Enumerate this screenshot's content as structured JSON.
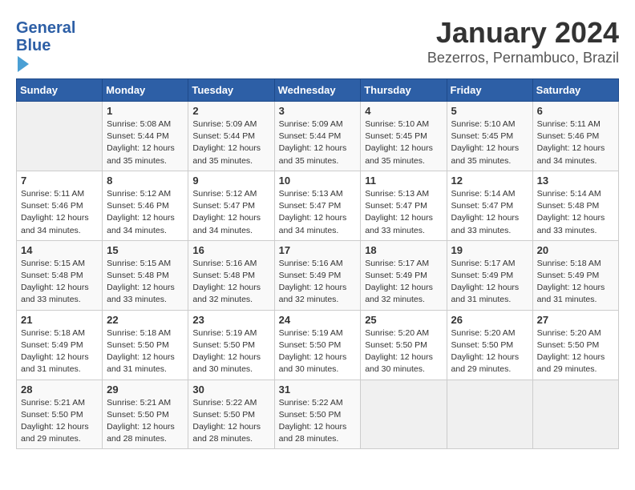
{
  "logo": {
    "line1": "General",
    "line2": "Blue"
  },
  "title": "January 2024",
  "subtitle": "Bezerros, Pernambuco, Brazil",
  "days_header": [
    "Sunday",
    "Monday",
    "Tuesday",
    "Wednesday",
    "Thursday",
    "Friday",
    "Saturday"
  ],
  "weeks": [
    [
      {
        "day": "",
        "info": ""
      },
      {
        "day": "1",
        "info": "Sunrise: 5:08 AM\nSunset: 5:44 PM\nDaylight: 12 hours\nand 35 minutes."
      },
      {
        "day": "2",
        "info": "Sunrise: 5:09 AM\nSunset: 5:44 PM\nDaylight: 12 hours\nand 35 minutes."
      },
      {
        "day": "3",
        "info": "Sunrise: 5:09 AM\nSunset: 5:44 PM\nDaylight: 12 hours\nand 35 minutes."
      },
      {
        "day": "4",
        "info": "Sunrise: 5:10 AM\nSunset: 5:45 PM\nDaylight: 12 hours\nand 35 minutes."
      },
      {
        "day": "5",
        "info": "Sunrise: 5:10 AM\nSunset: 5:45 PM\nDaylight: 12 hours\nand 35 minutes."
      },
      {
        "day": "6",
        "info": "Sunrise: 5:11 AM\nSunset: 5:46 PM\nDaylight: 12 hours\nand 34 minutes."
      }
    ],
    [
      {
        "day": "7",
        "info": "Sunrise: 5:11 AM\nSunset: 5:46 PM\nDaylight: 12 hours\nand 34 minutes."
      },
      {
        "day": "8",
        "info": "Sunrise: 5:12 AM\nSunset: 5:46 PM\nDaylight: 12 hours\nand 34 minutes."
      },
      {
        "day": "9",
        "info": "Sunrise: 5:12 AM\nSunset: 5:47 PM\nDaylight: 12 hours\nand 34 minutes."
      },
      {
        "day": "10",
        "info": "Sunrise: 5:13 AM\nSunset: 5:47 PM\nDaylight: 12 hours\nand 34 minutes."
      },
      {
        "day": "11",
        "info": "Sunrise: 5:13 AM\nSunset: 5:47 PM\nDaylight: 12 hours\nand 33 minutes."
      },
      {
        "day": "12",
        "info": "Sunrise: 5:14 AM\nSunset: 5:47 PM\nDaylight: 12 hours\nand 33 minutes."
      },
      {
        "day": "13",
        "info": "Sunrise: 5:14 AM\nSunset: 5:48 PM\nDaylight: 12 hours\nand 33 minutes."
      }
    ],
    [
      {
        "day": "14",
        "info": "Sunrise: 5:15 AM\nSunset: 5:48 PM\nDaylight: 12 hours\nand 33 minutes."
      },
      {
        "day": "15",
        "info": "Sunrise: 5:15 AM\nSunset: 5:48 PM\nDaylight: 12 hours\nand 33 minutes."
      },
      {
        "day": "16",
        "info": "Sunrise: 5:16 AM\nSunset: 5:48 PM\nDaylight: 12 hours\nand 32 minutes."
      },
      {
        "day": "17",
        "info": "Sunrise: 5:16 AM\nSunset: 5:49 PM\nDaylight: 12 hours\nand 32 minutes."
      },
      {
        "day": "18",
        "info": "Sunrise: 5:17 AM\nSunset: 5:49 PM\nDaylight: 12 hours\nand 32 minutes."
      },
      {
        "day": "19",
        "info": "Sunrise: 5:17 AM\nSunset: 5:49 PM\nDaylight: 12 hours\nand 31 minutes."
      },
      {
        "day": "20",
        "info": "Sunrise: 5:18 AM\nSunset: 5:49 PM\nDaylight: 12 hours\nand 31 minutes."
      }
    ],
    [
      {
        "day": "21",
        "info": "Sunrise: 5:18 AM\nSunset: 5:49 PM\nDaylight: 12 hours\nand 31 minutes."
      },
      {
        "day": "22",
        "info": "Sunrise: 5:18 AM\nSunset: 5:50 PM\nDaylight: 12 hours\nand 31 minutes."
      },
      {
        "day": "23",
        "info": "Sunrise: 5:19 AM\nSunset: 5:50 PM\nDaylight: 12 hours\nand 30 minutes."
      },
      {
        "day": "24",
        "info": "Sunrise: 5:19 AM\nSunset: 5:50 PM\nDaylight: 12 hours\nand 30 minutes."
      },
      {
        "day": "25",
        "info": "Sunrise: 5:20 AM\nSunset: 5:50 PM\nDaylight: 12 hours\nand 30 minutes."
      },
      {
        "day": "26",
        "info": "Sunrise: 5:20 AM\nSunset: 5:50 PM\nDaylight: 12 hours\nand 29 minutes."
      },
      {
        "day": "27",
        "info": "Sunrise: 5:20 AM\nSunset: 5:50 PM\nDaylight: 12 hours\nand 29 minutes."
      }
    ],
    [
      {
        "day": "28",
        "info": "Sunrise: 5:21 AM\nSunset: 5:50 PM\nDaylight: 12 hours\nand 29 minutes."
      },
      {
        "day": "29",
        "info": "Sunrise: 5:21 AM\nSunset: 5:50 PM\nDaylight: 12 hours\nand 28 minutes."
      },
      {
        "day": "30",
        "info": "Sunrise: 5:22 AM\nSunset: 5:50 PM\nDaylight: 12 hours\nand 28 minutes."
      },
      {
        "day": "31",
        "info": "Sunrise: 5:22 AM\nSunset: 5:50 PM\nDaylight: 12 hours\nand 28 minutes."
      },
      {
        "day": "",
        "info": ""
      },
      {
        "day": "",
        "info": ""
      },
      {
        "day": "",
        "info": ""
      }
    ]
  ]
}
